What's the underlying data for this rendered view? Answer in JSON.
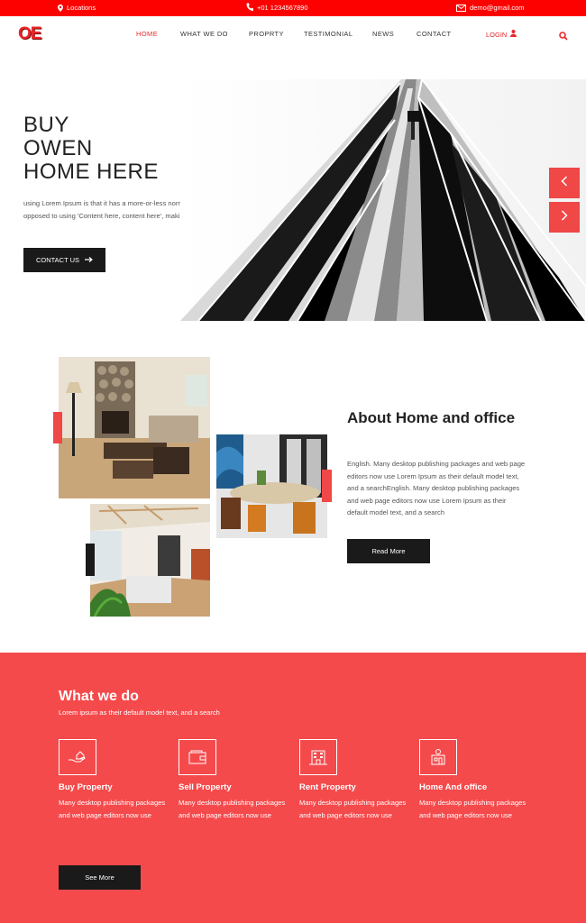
{
  "topbar": {
    "location": "Locations",
    "phone": "+01 1234567890",
    "email": "demo@gmail.com"
  },
  "nav": {
    "logo": "OE",
    "items": [
      "HOME",
      "WHAT WE DO",
      "PROPRTY",
      "TESTIMONIAL",
      "NEWS",
      "CONTACT"
    ],
    "login": "LOGIN"
  },
  "hero": {
    "title_lines": [
      "BUY",
      "OWEN",
      "HOME HERE"
    ],
    "text": "using Lorem Ipsum is that it has a more-or-less normal distribution of letters, as opposed to using 'Content here, content here', making it look like",
    "button": "CONTACT US"
  },
  "about": {
    "title": "About Home and office",
    "text": "English. Many desktop publishing packages and web page editors now use Lorem Ipsum as their default model text, and a searchEnglish. Many desktop publishing packages and web page editors now use Lorem Ipsum as their default model text, and a search",
    "button": "Read More"
  },
  "what_we_do": {
    "title": "What we do",
    "subtitle": "Lorem ipsum as their default model text, and a search",
    "services": [
      {
        "title": "Buy Property",
        "text": "Many desktop publishing packages and web page editors now use",
        "icon": "hand-house-icon"
      },
      {
        "title": "Sell Property",
        "text": "Many desktop publishing packages and web page editors now use",
        "icon": "wallet-icon"
      },
      {
        "title": "Rent Property",
        "text": "Many desktop publishing packages and web page editors now use",
        "icon": "building-icon"
      },
      {
        "title": "Home And office",
        "text": "Many desktop publishing packages and web page editors now use",
        "icon": "office-icon"
      }
    ],
    "button": "See More"
  },
  "colors": {
    "brand_red": "#fd0000",
    "accent_red": "#f04747",
    "section_red": "#f54a4c",
    "dark": "#1a1a1a"
  }
}
